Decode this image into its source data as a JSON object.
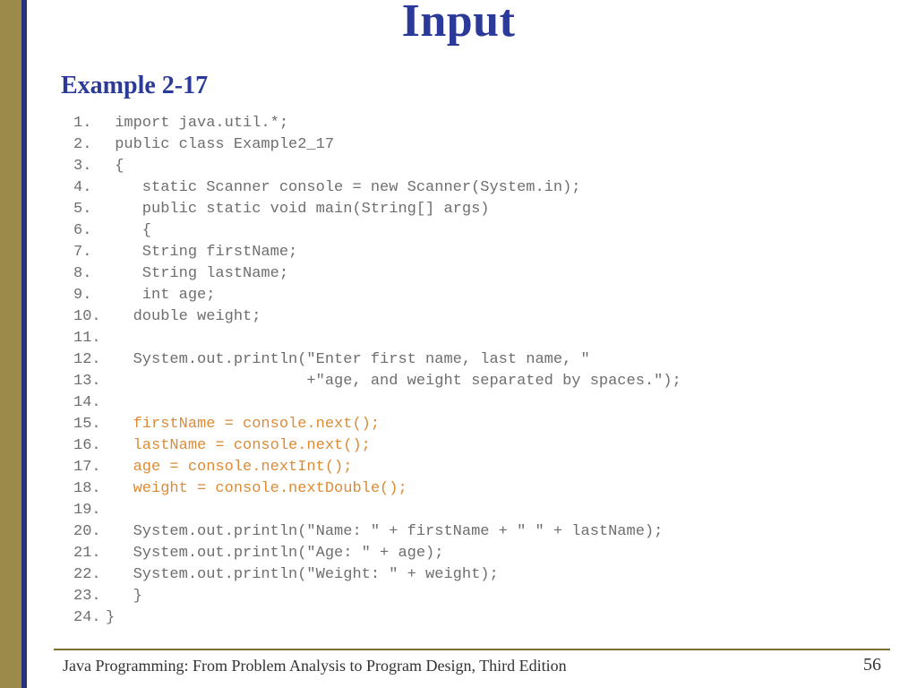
{
  "title": "Input",
  "subtitle": "Example 2-17",
  "footer": "Java Programming: From Problem Analysis to Program Design, Third Edition",
  "page": "56",
  "code": [
    {
      "n": "1.",
      "t": " import java.util.*;",
      "hl": false
    },
    {
      "n": "2.",
      "t": " public class Example2_17",
      "hl": false
    },
    {
      "n": "3.",
      "t": " {",
      "hl": false
    },
    {
      "n": "4.",
      "t": "    static Scanner console = new Scanner(System.in);",
      "hl": false
    },
    {
      "n": "5.",
      "t": "    public static void main(String[] args)",
      "hl": false
    },
    {
      "n": "6.",
      "t": "    {",
      "hl": false
    },
    {
      "n": "7.",
      "t": "    String firstName;",
      "hl": false
    },
    {
      "n": "8.",
      "t": "    String lastName;",
      "hl": false
    },
    {
      "n": "9.",
      "t": "    int age;",
      "hl": false
    },
    {
      "n": "10.",
      "t": "   double weight;",
      "hl": false
    },
    {
      "n": "11.",
      "t": "",
      "hl": false
    },
    {
      "n": "12.",
      "t": "   System.out.println(\"Enter first name, last name, \"",
      "hl": false
    },
    {
      "n": "13.",
      "t": "                      +\"age, and weight separated by spaces.\");",
      "hl": false
    },
    {
      "n": "14.",
      "t": "",
      "hl": false
    },
    {
      "n": "15.",
      "t": "   firstName = console.next();",
      "hl": true
    },
    {
      "n": "16.",
      "t": "   lastName = console.next();",
      "hl": true
    },
    {
      "n": "17.",
      "t": "   age = console.nextInt();",
      "hl": true
    },
    {
      "n": "18.",
      "t": "   weight = console.nextDouble();",
      "hl": true
    },
    {
      "n": "19.",
      "t": "",
      "hl": false
    },
    {
      "n": "20.",
      "t": "   System.out.println(\"Name: \" + firstName + \" \" + lastName);",
      "hl": false
    },
    {
      "n": "21.",
      "t": "   System.out.println(\"Age: \" + age);",
      "hl": false
    },
    {
      "n": "22.",
      "t": "   System.out.println(\"Weight: \" + weight);",
      "hl": false
    },
    {
      "n": "23.",
      "t": "   }",
      "hl": false
    },
    {
      "n": "24.",
      "t": "}",
      "hl": false
    }
  ]
}
